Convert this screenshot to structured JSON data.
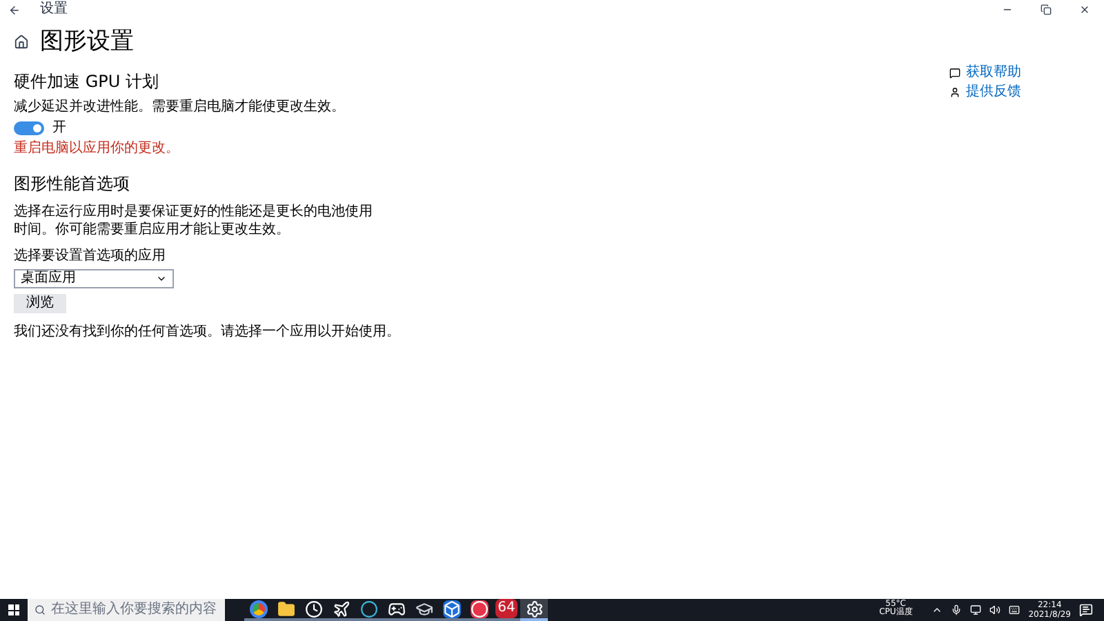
{
  "window": {
    "title": "设置"
  },
  "page": {
    "title": "图形设置"
  },
  "gpu_section": {
    "heading": "硬件加速 GPU 计划",
    "description": "减少延迟并改进性能。需要重启电脑才能使更改生效。",
    "toggle": {
      "on": true,
      "label": "开"
    },
    "warning": "重启电脑以应用你的更改。"
  },
  "pref_section": {
    "heading": "图形性能首选项",
    "description": "选择在运行应用时是要保证更好的性能还是更长的电池使用时间。你可能需要重启应用才能让更改生效。",
    "select_label": "选择要设置首选项的应用",
    "select_value": "桌面应用",
    "browse_button": "浏览",
    "empty_note": "我们还没有找到你的任何首选项。请选择一个应用以开始使用。"
  },
  "side_links": [
    {
      "kind": "help",
      "label": "获取帮助"
    },
    {
      "kind": "feedback",
      "label": "提供反馈"
    }
  ],
  "taskbar": {
    "search_placeholder": "在这里输入你要搜索的内容",
    "apps": [
      {
        "kind": "browser",
        "selected": false
      },
      {
        "kind": "folder",
        "selected": false
      },
      {
        "kind": "clock",
        "selected": false
      },
      {
        "kind": "plane",
        "selected": false
      },
      {
        "kind": "circle",
        "selected": false
      },
      {
        "kind": "steam",
        "selected": false
      },
      {
        "kind": "cap",
        "selected": false
      },
      {
        "kind": "cube",
        "selected": false
      },
      {
        "kind": "ring",
        "selected": false
      },
      {
        "kind": "badge",
        "label": "64",
        "selected": false
      },
      {
        "kind": "gear",
        "selected": true
      }
    ],
    "temp": "55°C",
    "temp_label": "CPU温度",
    "time": "22:14",
    "date": "2021/8/29"
  }
}
